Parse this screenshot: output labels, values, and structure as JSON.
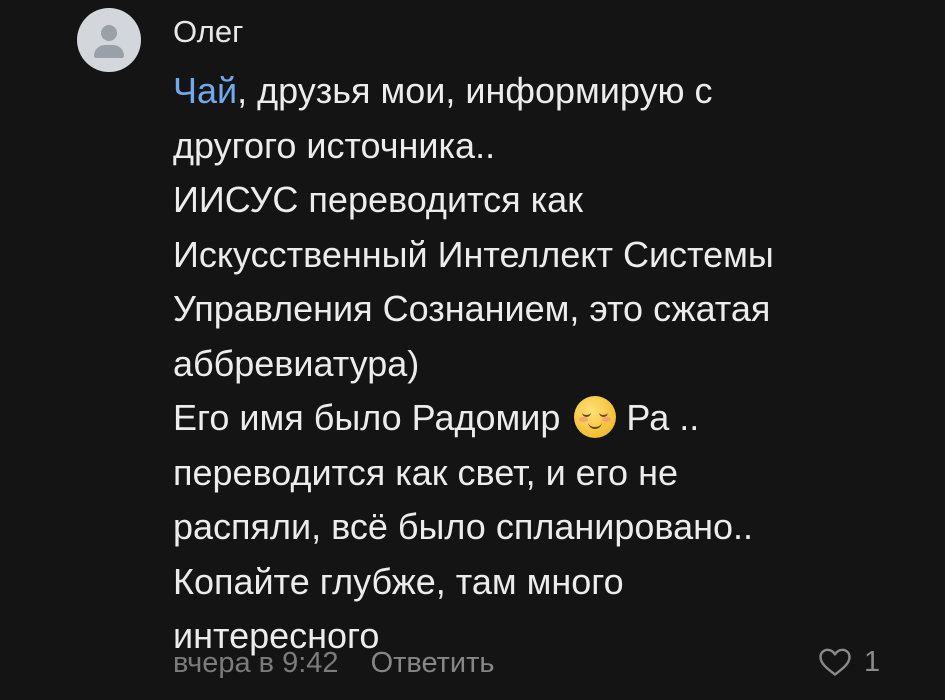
{
  "comment": {
    "author": "Олег",
    "mention": "Чай",
    "text_lines": [
      ", друзья мои, информирую с",
      "другого источника..",
      "ИИСУС переводится как",
      "Искусственный Интеллект Системы",
      "Управления Сознанием, это сжатая",
      "аббревиатура)",
      "Его имя было Радомир",
      "Ра ..",
      "переводится как свет, и его не",
      "распяли, всё было спланировано..",
      "Копайте глубже, там много",
      "интересного"
    ],
    "emoji": "smiling-face-with-smiling-eyes",
    "timestamp": "вчера в 9:42",
    "reply_label": "Ответить",
    "likes_count": "1"
  },
  "colors": {
    "background": "#141414",
    "text": "#ececec",
    "mention": "#71aaeb",
    "muted": "#7b7b7b"
  },
  "icons": {
    "avatar": "default-user-avatar-icon",
    "like": "heart-outline-icon"
  }
}
